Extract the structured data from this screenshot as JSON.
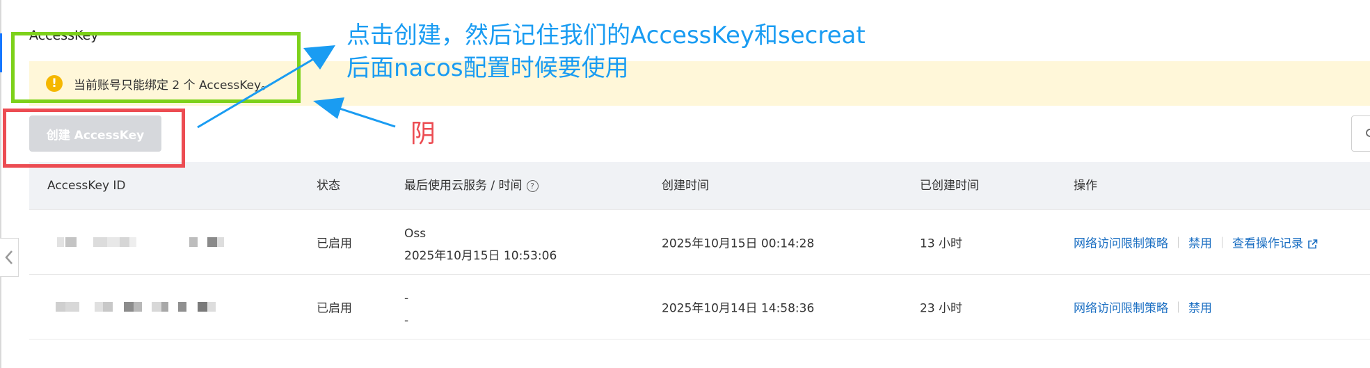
{
  "page": {
    "title": "AccessKey",
    "notice_text": "当前账号只能绑定 2 个 AccessKey。",
    "notice_icon": "warning-icon",
    "create_button_label": "创建 AccessKey"
  },
  "table": {
    "headers": {
      "id": "AccessKey ID",
      "status": "状态",
      "last_used": "最后使用云服务 / 时间",
      "created": "创建时间",
      "age": "已创建时间",
      "ops": "操作"
    },
    "rows": [
      {
        "status": "已启用",
        "last_used_service": "Oss",
        "last_used_time": "2025年10月15日 10:53:06",
        "created": "2025年10月15日 00:14:28",
        "age": "13 小时",
        "actions": [
          "网络访问限制策略",
          "禁用",
          "查看操作记录"
        ]
      },
      {
        "status": "已启用",
        "last_used_service": "-",
        "last_used_time": "-",
        "created": "2025年10月14日 14:58:36",
        "age": "23 小时",
        "actions": [
          "网络访问限制策略",
          "禁用"
        ]
      }
    ]
  },
  "annotations": {
    "blue_line1": "点击创建，然后记住我们的AccessKey和secreat",
    "blue_line2": "后面nacos配置时候要使用",
    "red_label": "阴"
  },
  "colors": {
    "annotation_blue": "#1a9cf2",
    "annotation_red": "#ec4c52",
    "annotation_green": "#7dd11a",
    "link": "#1a6ec2",
    "notice_bg": "#fff7d9"
  }
}
